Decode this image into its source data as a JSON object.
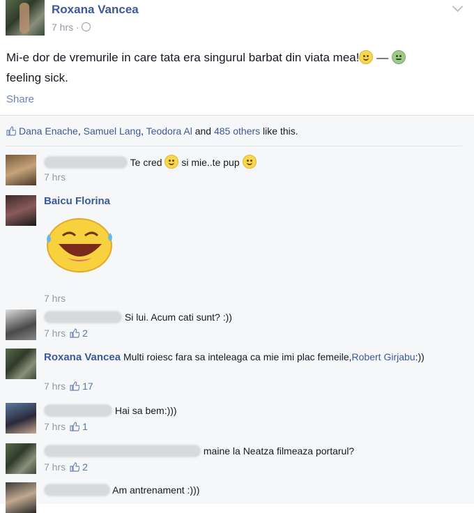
{
  "post": {
    "author": "Roxana Vancea",
    "time": "7 hrs ·",
    "text": "Mi-e dor de vremurile in care tata era singurul barbat din viata mea!",
    "dash": " — ",
    "feeling": "feeling sick.",
    "share_label": "Share"
  },
  "likes": {
    "names": [
      "Dana Enache",
      "Samuel Lang",
      "Teodora Al"
    ],
    "sep1": ", ",
    "sep2": ", ",
    "and": " and ",
    "others": "485 others",
    "tail": " like this."
  },
  "comments": [
    {
      "author": "",
      "text": "Te cred ",
      "text2": " si mie..te pup ",
      "time": "7 hrs"
    },
    {
      "author": "Baicu Florina",
      "text": "",
      "time": "7 hrs"
    },
    {
      "author": "",
      "text": "Si lui. Acum cati sunt? :))",
      "time": "7 hrs",
      "likes": "2"
    },
    {
      "author": "Roxana Vancea",
      "text": " Multi roiesc fara sa inteleaga ca mie imi plac femeile,",
      "mention": "Robert Girjabu",
      "text_tail": ":))",
      "time": "7 hrs",
      "likes": "17"
    },
    {
      "author": "",
      "text": "Hai sa bem:)))",
      "time": "7 hrs",
      "likes": "1"
    },
    {
      "author": "",
      "text": " maine la Neatza filmeaza portarul?",
      "time": "7 hrs",
      "likes": "2"
    },
    {
      "author": "",
      "text": "Am antrenament :)))",
      "time": ""
    }
  ],
  "colors": {
    "link": "#3b5998",
    "meta": "#9197a3",
    "feed_bg": "#f6f7f9"
  }
}
